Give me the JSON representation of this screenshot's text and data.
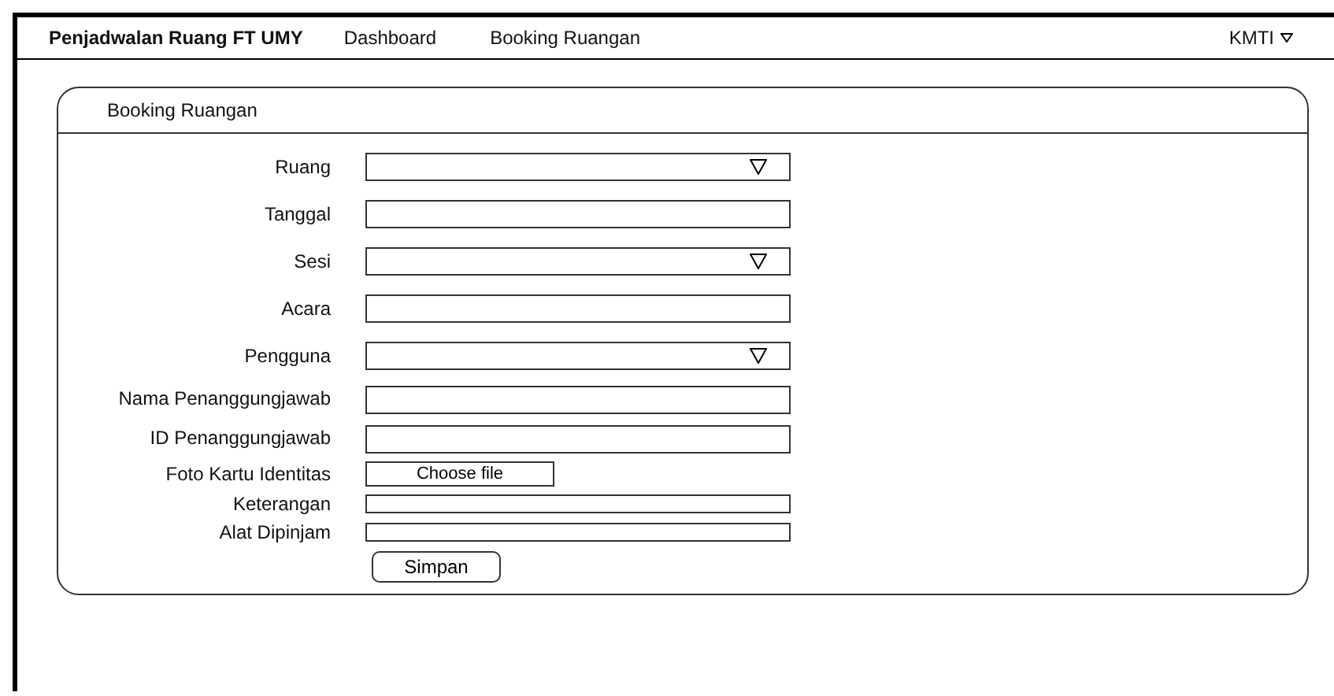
{
  "navbar": {
    "brand": "Penjadwalan Ruang FT UMY",
    "links": [
      "Dashboard",
      "Booking Ruangan"
    ],
    "user": "KMTI"
  },
  "panel": {
    "title": "Booking Ruangan",
    "fields": [
      {
        "label": "Ruang",
        "kind": "dropdown"
      },
      {
        "label": "Tanggal",
        "kind": "text"
      },
      {
        "label": "Sesi",
        "kind": "dropdown"
      },
      {
        "label": "Acara",
        "kind": "text"
      },
      {
        "label": "Pengguna",
        "kind": "dropdown"
      },
      {
        "label": "Nama Penanggungjawab",
        "kind": "text"
      },
      {
        "label": "ID Penanggungjawab",
        "kind": "text"
      },
      {
        "label": "Foto Kartu Identitas",
        "kind": "file",
        "button": "Choose file"
      },
      {
        "label": "Keterangan",
        "kind": "text"
      },
      {
        "label": "Alat Dipinjam",
        "kind": "text"
      }
    ],
    "submit": "Simpan"
  }
}
